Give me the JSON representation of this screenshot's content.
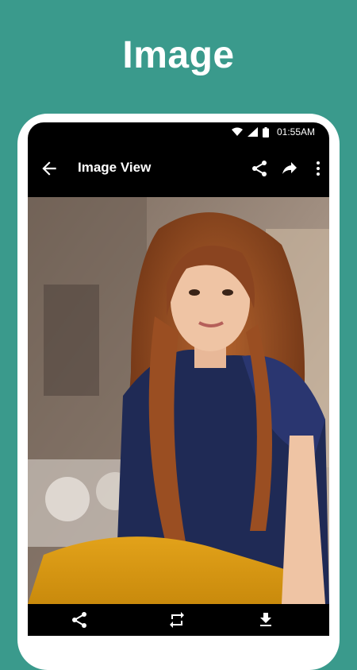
{
  "promo": {
    "title": "Image"
  },
  "status_bar": {
    "time": "01:55AM"
  },
  "app_bar": {
    "title": "Image View"
  },
  "icons": {
    "back": "arrow-back-icon",
    "share": "share-icon",
    "forward": "forward-icon",
    "more": "more-vert-icon",
    "rotate": "repeat-icon",
    "download": "download-icon"
  },
  "colors": {
    "background": "#3a9a8c",
    "frame": "#ffffff",
    "bars": "#000000"
  }
}
